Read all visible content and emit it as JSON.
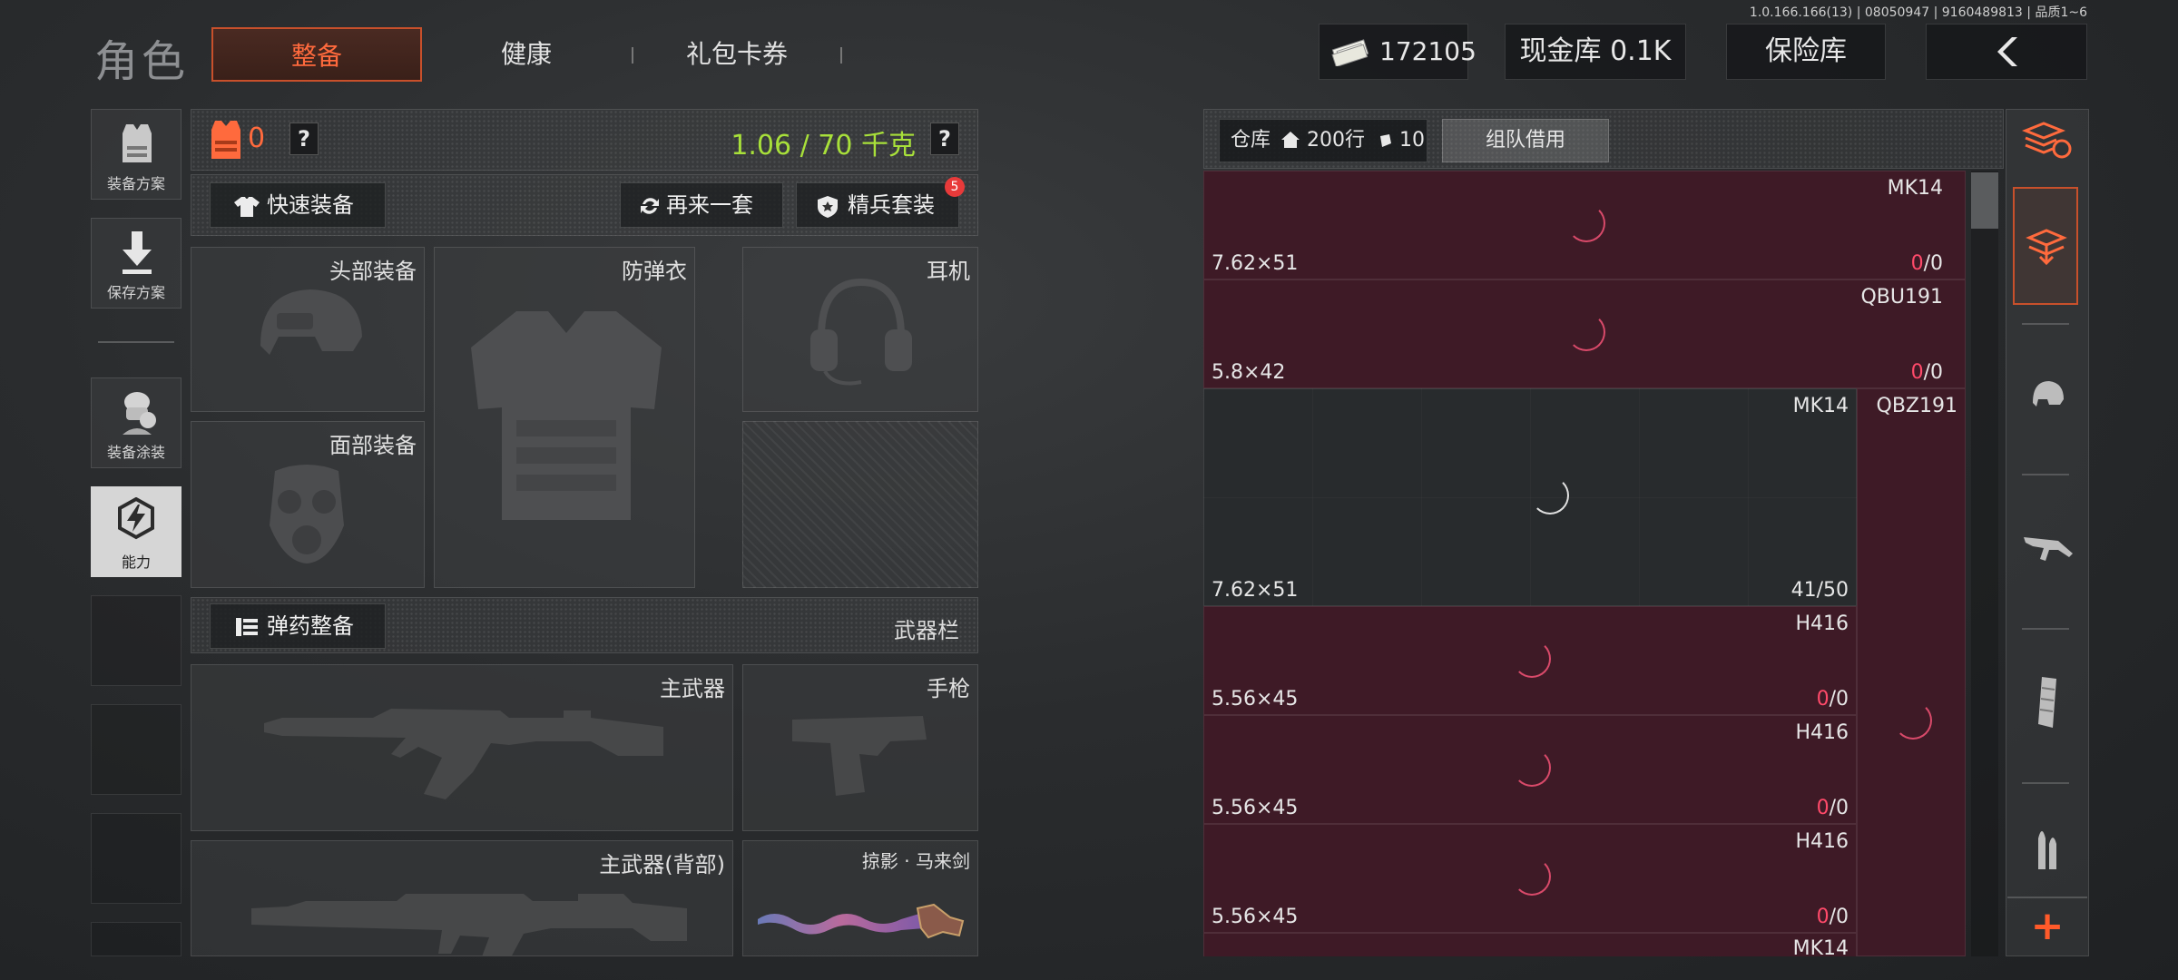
{
  "version": "1.0.166.166(13) | 08050947 | 9160489813 | 品质1~6",
  "title": "角色",
  "tabs": [
    "整备",
    "健康",
    "礼包卡券"
  ],
  "top": {
    "money": "172105",
    "cash_vault": "现金库 0.1K",
    "safe_box": "保险库",
    "back_icon": "chevron-left-icon"
  },
  "sidebar": {
    "items": [
      {
        "label": "装备方案",
        "icon": "vest-icon"
      },
      {
        "label": "保存方案",
        "icon": "download-icon"
      },
      {
        "label": "装备涂装",
        "icon": "operator-icon"
      },
      {
        "label": "能力",
        "icon": "lightning-hex-icon"
      }
    ]
  },
  "equip": {
    "armor_count": "0",
    "weight": "1.06 / 70 千克",
    "help": "?",
    "quick_equip": "快速装备",
    "again": "再来一套",
    "elite": "精兵套装",
    "elite_badge": "5",
    "slots": {
      "head": "头部装备",
      "armor": "防弹衣",
      "headset": "耳机",
      "face": "面部装备"
    },
    "ammo_btn": "弹药整备",
    "weapon_bar": "武器栏",
    "weapons": {
      "primary": "主武器",
      "pistol": "手枪",
      "primary_back": "主武器(背部)",
      "melee": "掠影 · 马来剑"
    }
  },
  "inventory": {
    "warehouse": "仓库",
    "rows1": "200行",
    "rows2": "10行",
    "team_borrow": "组队借用",
    "items": [
      {
        "name": "MK14",
        "caliber": "7.62×51",
        "ammo_cur": "0",
        "ammo_max": "/0"
      },
      {
        "name": "QBU191",
        "caliber": "5.8×42",
        "ammo_cur": "0",
        "ammo_max": "/0"
      },
      {
        "name": "MK14",
        "caliber": "7.62×51",
        "ammo": "41/50"
      },
      {
        "name": "QBZ191"
      },
      {
        "name": "H416",
        "caliber": "5.56×45",
        "ammo_cur": "0",
        "ammo_max": "/0"
      },
      {
        "name": "H416",
        "caliber": "5.56×45",
        "ammo_cur": "0",
        "ammo_max": "/0"
      },
      {
        "name": "H416",
        "caliber": "5.56×45",
        "ammo_cur": "0",
        "ammo_max": "/0"
      },
      {
        "name": "MK14"
      }
    ]
  },
  "rail": {
    "add": "+"
  },
  "colors": {
    "accent": "#ff6a3d",
    "weight_green": "#a8e03a",
    "pink_cell": "#3e1a26",
    "red_count": "#ff4a6a"
  }
}
